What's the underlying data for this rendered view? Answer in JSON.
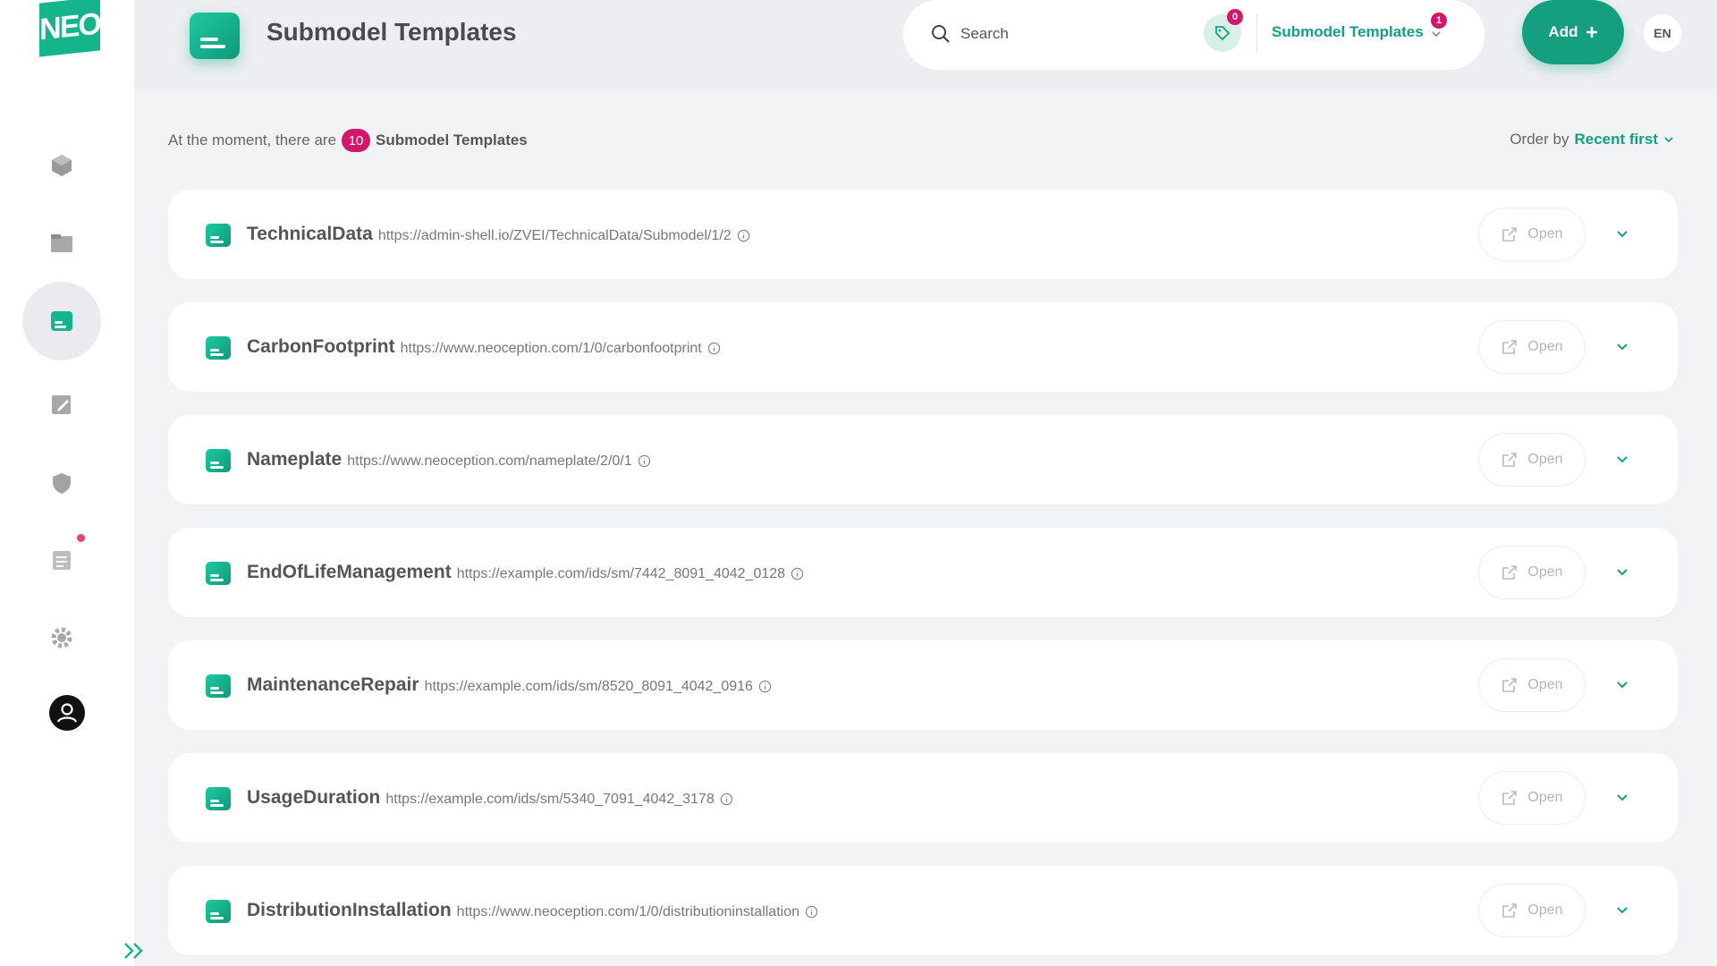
{
  "app": {
    "logo_text": "NEO",
    "page_title": "Submodel Templates"
  },
  "sidebar": {
    "items": [
      {
        "icon": "cube-icon",
        "active": false
      },
      {
        "icon": "folder-icon",
        "active": false
      },
      {
        "icon": "submodel-icon",
        "active": true
      },
      {
        "icon": "edit-icon",
        "active": false
      },
      {
        "icon": "shield-icon",
        "active": false
      },
      {
        "icon": "list-icon",
        "active": false,
        "has_dot": true
      },
      {
        "icon": "gear-icon",
        "active": false
      }
    ],
    "profile_icon": "user-icon",
    "expand_icon": "double-chevron-right-icon"
  },
  "header": {
    "search": {
      "placeholder": "Search",
      "value": ""
    },
    "tag_badge": "0",
    "scope": {
      "label": "Submodel Templates",
      "badge": "1"
    },
    "add_label": "Add",
    "language": "EN"
  },
  "summary": {
    "prefix": "At the moment, there are",
    "count": "10",
    "suffix": "Submodel Templates",
    "order_label": "Order by",
    "order_value": "Recent first"
  },
  "rows": [
    {
      "name": "TechnicalData",
      "url": "https://admin-shell.io/ZVEI/TechnicalData/Submodel/1/2",
      "open_label": "Open"
    },
    {
      "name": "CarbonFootprint",
      "url": "https://www.neoception.com/1/0/carbonfootprint",
      "open_label": "Open"
    },
    {
      "name": "Nameplate",
      "url": "https://www.neoception.com/nameplate/2/0/1",
      "open_label": "Open"
    },
    {
      "name": "EndOfLifeManagement",
      "url": "https://example.com/ids/sm/7442_8091_4042_0128",
      "open_label": "Open"
    },
    {
      "name": "MaintenanceRepair",
      "url": "https://example.com/ids/sm/8520_8091_4042_0916",
      "open_label": "Open"
    },
    {
      "name": "UsageDuration",
      "url": "https://example.com/ids/sm/5340_7091_4042_3178",
      "open_label": "Open"
    },
    {
      "name": "DistributionInstallation",
      "url": "https://www.neoception.com/1/0/distributioninstallation",
      "open_label": "Open"
    }
  ],
  "colors": {
    "brand": "#14b48c",
    "accent": "#14a07f",
    "badge": "#d3176a",
    "background": "#f2f3f5"
  }
}
